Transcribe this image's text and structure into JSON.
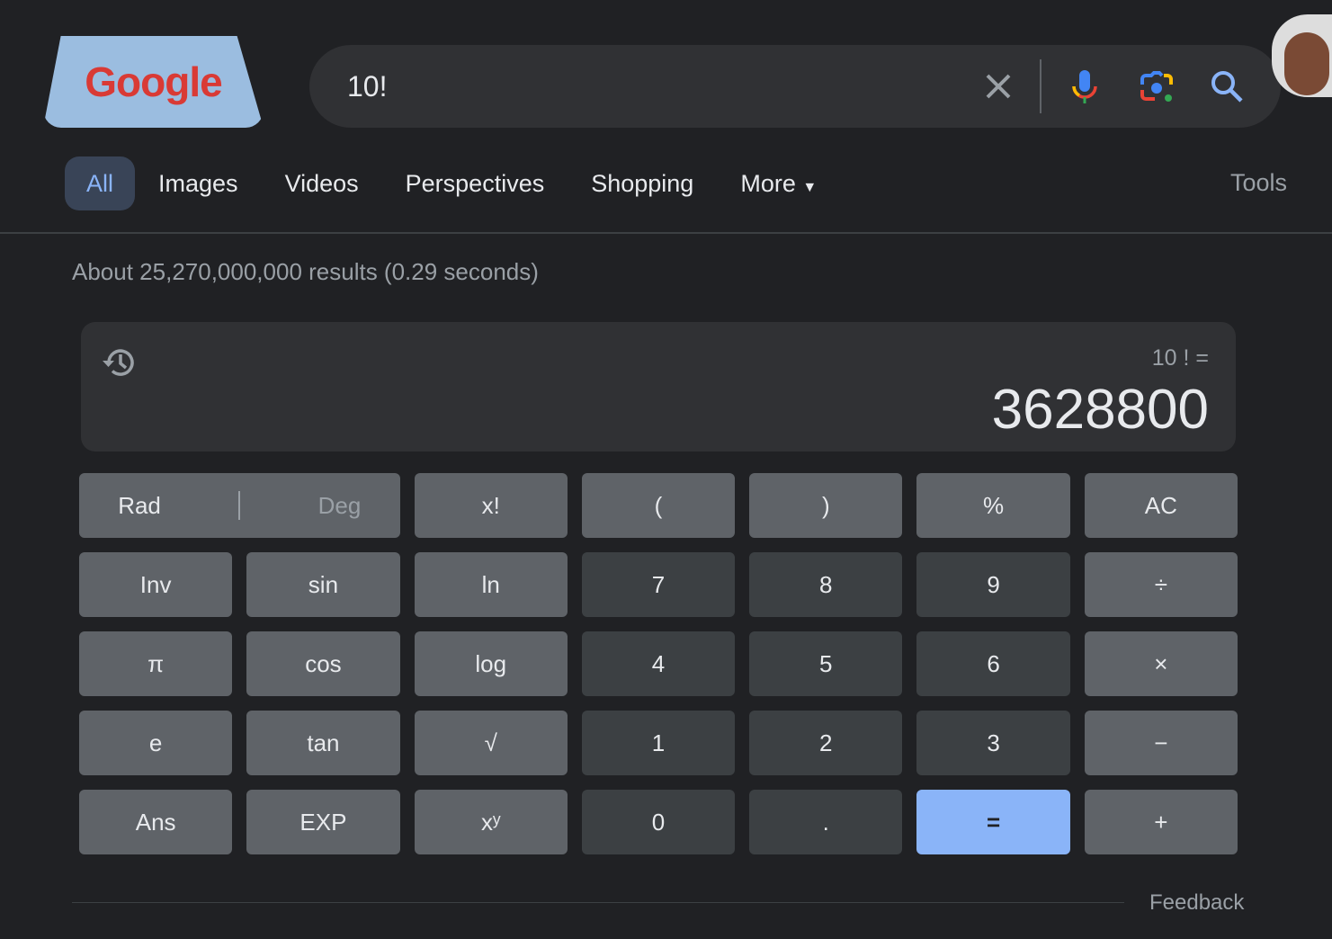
{
  "logo": {
    "text": "Google"
  },
  "search": {
    "value": "10!"
  },
  "tabs": [
    {
      "label": "All"
    },
    {
      "label": "Images"
    },
    {
      "label": "Videos"
    },
    {
      "label": "Perspectives"
    },
    {
      "label": "Shopping"
    },
    {
      "label": "More"
    }
  ],
  "tools_label": "Tools",
  "stats": "About 25,270,000,000 results (0.29 seconds)",
  "calculator": {
    "expression": "10 ! =",
    "result": "3628800",
    "rad": "Rad",
    "deg": "Deg",
    "keys": [
      "x!",
      "(",
      ")",
      "%",
      "AC",
      "Inv",
      "sin",
      "ln",
      "7",
      "8",
      "9",
      "÷",
      "π",
      "cos",
      "log",
      "4",
      "5",
      "6",
      "×",
      "e",
      "tan",
      "√",
      "1",
      "2",
      "3",
      "−",
      "Ans",
      "EXP",
      "xʸ",
      "0",
      ".",
      "=",
      "+"
    ]
  },
  "feedback": "Feedback",
  "colors": {
    "background": "#202124",
    "function_key": "#5f6368",
    "number_key": "#3c4043",
    "equals_key": "#8ab4f8",
    "accent": "#8ab4f8"
  }
}
